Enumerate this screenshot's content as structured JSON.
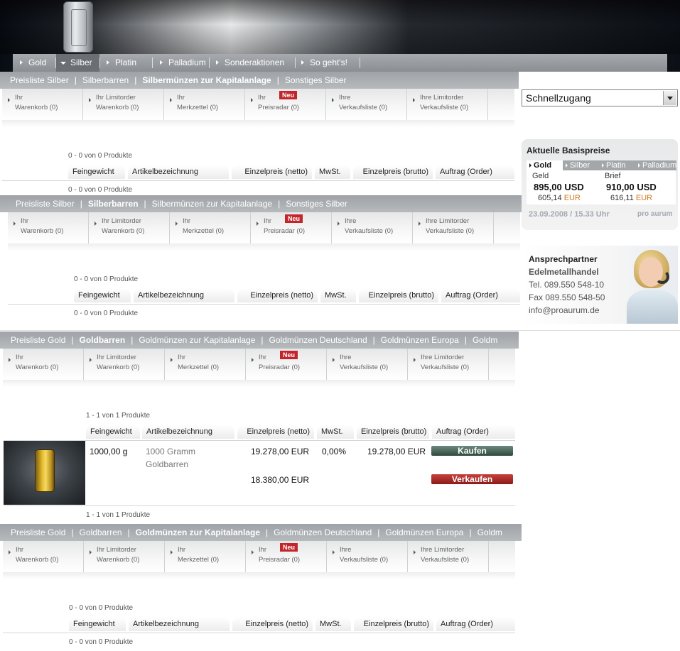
{
  "main_nav": [
    {
      "label": "Gold",
      "active": false
    },
    {
      "label": "Silber",
      "active": true
    },
    {
      "label": "Platin",
      "active": false
    },
    {
      "label": "Palladium",
      "active": false
    },
    {
      "label": "Sonderaktionen",
      "active": false
    },
    {
      "label": "So geht's!",
      "active": false
    }
  ],
  "silver_links": [
    "Preisliste Silber",
    "Silberbarren",
    "Silbermünzen zur Kapitalanlage",
    "Sonstiges Silber"
  ],
  "gold_links": [
    "Preisliste Gold",
    "Goldbarren",
    "Goldmünzen zur Kapitalanlage",
    "Goldmünzen Deutschland",
    "Goldmünzen Europa",
    "Goldm"
  ],
  "tools": [
    {
      "line1": "Ihr",
      "line2": "Warenkorb (0)"
    },
    {
      "line1": "Ihr Limitorder",
      "line2": "Warenkorb (0)"
    },
    {
      "line1": "Ihr",
      "line2": "Merkzettel (0)"
    },
    {
      "line1": "Ihr",
      "line2": "Preisradar (0)",
      "badge": "Neu"
    },
    {
      "line1": "Ihre",
      "line2": "Verkaufsliste (0)"
    },
    {
      "line1": "Ihre Limitorder",
      "line2": "Verkaufsliste (0)"
    }
  ],
  "columns": [
    "Feingewicht",
    "Artikelbezeichnung",
    "Einzelpreis (netto)",
    "MwSt.",
    "Einzelpreis (brutto)",
    "Auftrag (Order)"
  ],
  "sections": [
    {
      "count": "0 - 0 von 0 Produkte"
    },
    {
      "count": "0 - 0 von 0 Produkte"
    },
    {
      "count": "1 - 1 von 1 Produkte"
    },
    {
      "count": "0 - 0 von 0 Produkte"
    }
  ],
  "product": {
    "weight": "1000,00 g",
    "name": "1000 Gramm Goldbarren",
    "price_net": "19.278,00 EUR",
    "vat": "0,00%",
    "price_gross": "19.278,00 EUR",
    "buy_label": "Kaufen",
    "sell_price": "18.380,00 EUR",
    "sell_label": "Verkaufen"
  },
  "quick_access": "Schnellzugang",
  "prices": {
    "title": "Aktuelle Basispreise",
    "tabs": [
      "Gold",
      "Silber",
      "Platin",
      "Palladium"
    ],
    "bid_label": "Geld",
    "ask_label": "Brief",
    "bid_usd": "895,00 USD",
    "bid_eur": "605,14",
    "ask_usd": "910,00 USD",
    "ask_eur": "616,11",
    "eur": "EUR",
    "datetime": "23.09.2008 / 15.33 Uhr",
    "brand": "pro aurum"
  },
  "contact": {
    "title": "Ansprechpartner",
    "subtitle": "Edelmetallhandel",
    "tel": "Tel.  089.550 548-10",
    "fax": "Fax  089.550 548-50",
    "email": "info@proaurum.de"
  },
  "colors": {
    "accent_red": "#c2262b",
    "buy_green": "#2e4a3e",
    "sell_red": "#8a1c18",
    "eur_orange": "#d07a1a"
  }
}
